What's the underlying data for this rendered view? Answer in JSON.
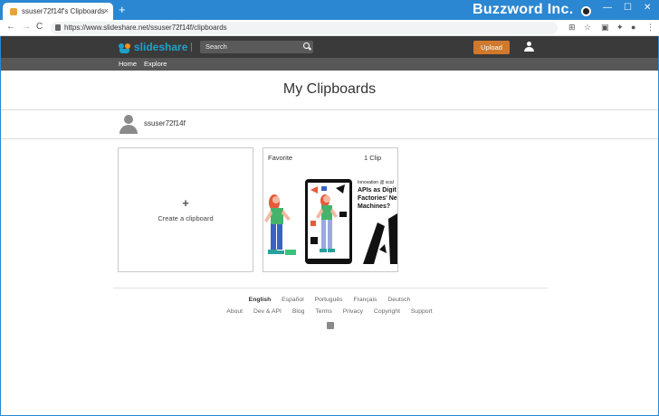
{
  "browser": {
    "tab_title": "ssuser72f14f's Clipboards",
    "tab_close": "×",
    "new_tab": "+",
    "brand": "Buzzword Inc.",
    "url": "https://www.slideshare.net/ssuser72f14f/clipboards",
    "nav": {
      "back": "←",
      "forward": "→",
      "reload": "C"
    },
    "window_controls": {
      "minimize": "—",
      "maximize": "☐",
      "close": "✕"
    }
  },
  "header": {
    "logo_text": "slideshare",
    "search_placeholder": "Search",
    "upload_label": "Upload"
  },
  "subnav": {
    "home": "Home",
    "explore": "Explore"
  },
  "main": {
    "title": "My Clipboards",
    "username": "ssuser72f14f",
    "create_label": "Create a clipboard",
    "create_plus": "+",
    "clipboards": [
      {
        "name": "Favorite",
        "count": "1 Clip",
        "thumb": {
          "kicker": "Innovation @ scal",
          "title_lines": [
            "APIs as Digit",
            "Factories' Ne",
            "Machines?"
          ]
        }
      }
    ]
  },
  "footer": {
    "languages": [
      "English",
      "Español",
      "Português",
      "Français",
      "Deutsch"
    ],
    "links": [
      "About",
      "Dev & API",
      "Blog",
      "Terms",
      "Privacy",
      "Copyright",
      "Support"
    ]
  },
  "colors": {
    "chrome_blue": "#2b87d1",
    "header_dark": "#3a3a3a",
    "subnav": "#575757",
    "upload_orange": "#d0792d",
    "logo_blue": "#1ea1c9"
  }
}
